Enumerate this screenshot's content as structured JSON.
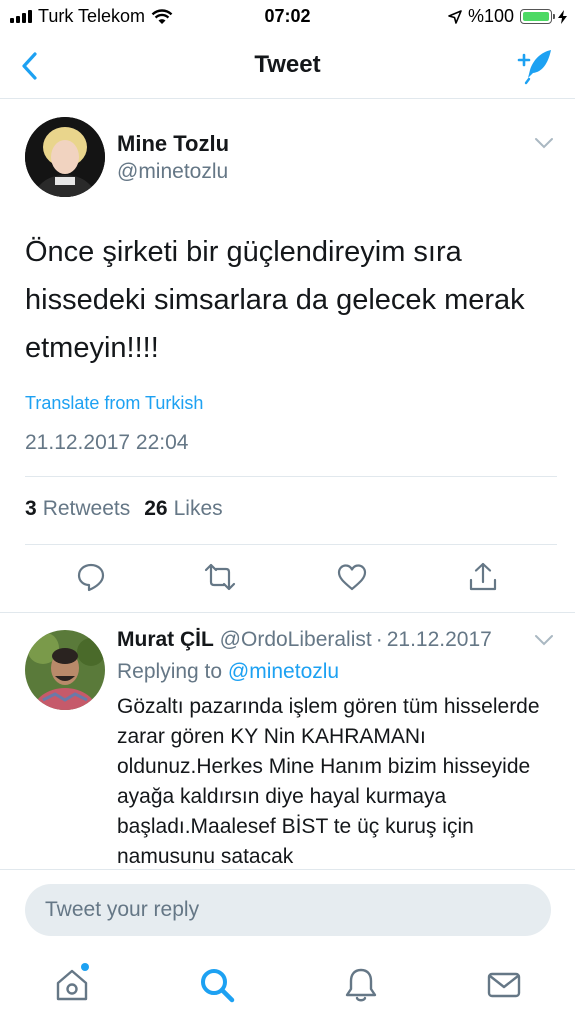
{
  "status_bar": {
    "carrier": "Turk Telekom",
    "time": "07:02",
    "battery": "%100",
    "battery_level": 1.0
  },
  "nav": {
    "title": "Tweet",
    "back_icon": "chevron-left-icon",
    "compose_icon": "compose-tweet-icon"
  },
  "tweet": {
    "author_name": "Mine Tozlu",
    "author_handle": "@minetozlu",
    "text": "Önce şirketi bir güçlendireyim sıra hissedeki simsarlara da gelecek merak etmeyin!!!!",
    "translate_label": "Translate from Turkish",
    "timestamp": "21.12.2017 22:04",
    "retweets_count": "3",
    "retweets_label": "Retweets",
    "likes_count": "26",
    "likes_label": "Likes"
  },
  "actions": [
    "reply-icon",
    "retweet-icon",
    "like-icon",
    "share-icon"
  ],
  "reply": {
    "author_name": "Murat ÇİL",
    "author_handle": "@OrdoLiberalist",
    "separator": "·",
    "date": "21.12.2017",
    "replying_prefix": "Replying to",
    "replying_to": "@minetozlu",
    "text": "Gözaltı pazarında işlem gören tüm hisselerde zarar gören KY Nin KAHRAMANı oldunuz.Herkes Mine Hanım bizim hisseyide ayağa kaldırsın diye hayal kurmaya başladı.Maalesef BİST te üç kuruş için namusunu satacak"
  },
  "composer": {
    "placeholder": "Tweet your reply"
  },
  "tab_bar": {
    "items": [
      "home-icon",
      "search-icon",
      "notifications-icon",
      "messages-icon"
    ]
  },
  "colors": {
    "accent": "#1da1f2",
    "secondary_text": "#657786",
    "primary_text": "#14171a",
    "divider": "#e1e8ed",
    "battery": "#4cd964"
  }
}
